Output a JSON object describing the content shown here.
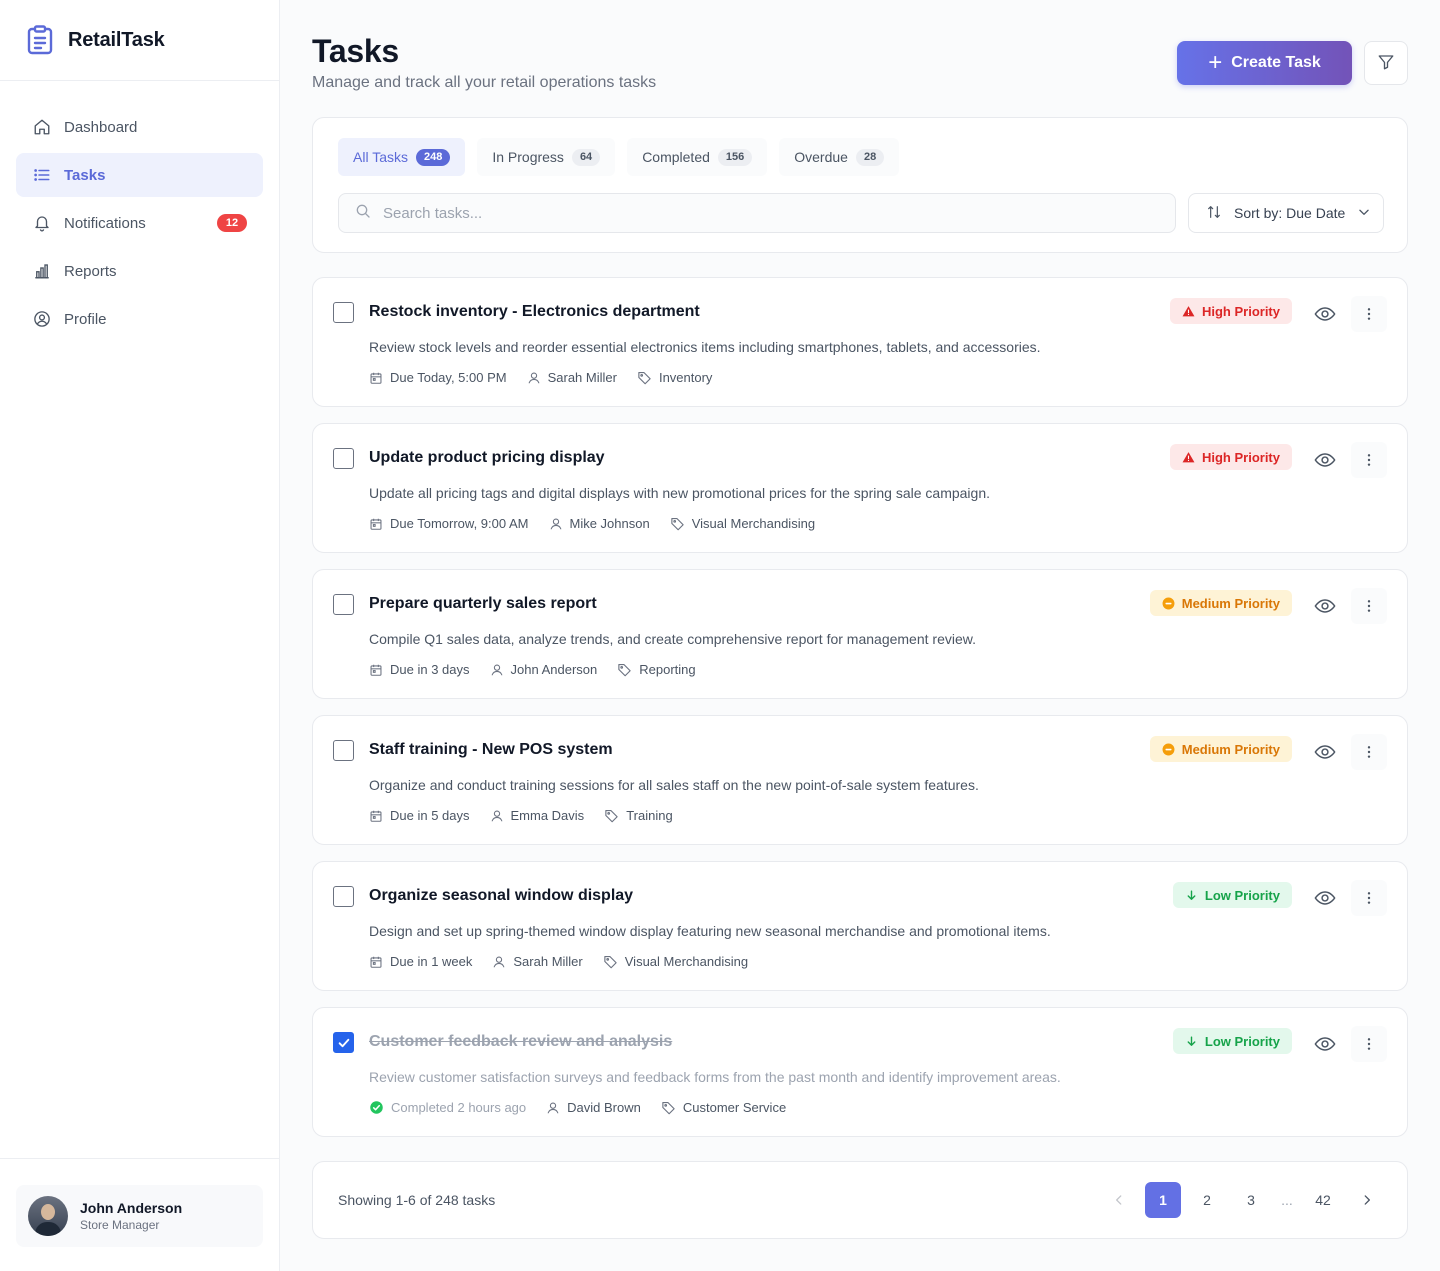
{
  "brand": {
    "name": "RetailTask"
  },
  "nav": [
    {
      "label": "Dashboard",
      "icon": "home-icon",
      "active": false
    },
    {
      "label": "Tasks",
      "icon": "list-icon",
      "active": true
    },
    {
      "label": "Notifications",
      "icon": "bell-icon",
      "active": false,
      "badge": "12"
    },
    {
      "label": "Reports",
      "icon": "bar-chart-icon",
      "active": false
    },
    {
      "label": "Profile",
      "icon": "user-circle-icon",
      "active": false
    }
  ],
  "user": {
    "name": "John Anderson",
    "role": "Store Manager"
  },
  "header": {
    "title": "Tasks",
    "subtitle": "Manage and track all your retail operations tasks",
    "create_label": "Create Task"
  },
  "tabs": [
    {
      "label": "All Tasks",
      "count": "248",
      "active": true
    },
    {
      "label": "In Progress",
      "count": "64",
      "active": false
    },
    {
      "label": "Completed",
      "count": "156",
      "active": false
    },
    {
      "label": "Overdue",
      "count": "28",
      "active": false
    }
  ],
  "search": {
    "placeholder": "Search tasks...",
    "value": ""
  },
  "sort": {
    "label": "Sort by: Due Date"
  },
  "tasks": [
    {
      "title": "Restock inventory - Electronics department",
      "description": "Review stock levels and reorder essential electronics items including smartphones, tablets, and accessories.",
      "due": "Due Today, 5:00 PM",
      "assignee": "Sarah Miller",
      "category": "Inventory",
      "priority": "High Priority",
      "level": "high",
      "completed": false
    },
    {
      "title": "Update product pricing display",
      "description": "Update all pricing tags and digital displays with new promotional prices for the spring sale campaign.",
      "due": "Due Tomorrow, 9:00 AM",
      "assignee": "Mike Johnson",
      "category": "Visual Merchandising",
      "priority": "High Priority",
      "level": "high",
      "completed": false
    },
    {
      "title": "Prepare quarterly sales report",
      "description": "Compile Q1 sales data, analyze trends, and create comprehensive report for management review.",
      "due": "Due in 3 days",
      "assignee": "John Anderson",
      "category": "Reporting",
      "priority": "Medium Priority",
      "level": "medium",
      "completed": false
    },
    {
      "title": "Staff training - New POS system",
      "description": "Organize and conduct training sessions for all sales staff on the new point-of-sale system features.",
      "due": "Due in 5 days",
      "assignee": "Emma Davis",
      "category": "Training",
      "priority": "Medium Priority",
      "level": "medium",
      "completed": false
    },
    {
      "title": "Organize seasonal window display",
      "description": "Design and set up spring-themed window display featuring new seasonal merchandise and promotional items.",
      "due": "Due in 1 week",
      "assignee": "Sarah Miller",
      "category": "Visual Merchandising",
      "priority": "Low Priority",
      "level": "low",
      "completed": false
    },
    {
      "title": "Customer feedback review and analysis",
      "description": "Review customer satisfaction surveys and feedback forms from the past month and identify improvement areas.",
      "due": "Completed 2 hours ago",
      "assignee": "David Brown",
      "category": "Customer Service",
      "priority": "Low Priority",
      "level": "low",
      "completed": true
    }
  ],
  "pagination": {
    "showing": "Showing 1-6 of 248 tasks",
    "pages": [
      "1",
      "2",
      "3",
      "...",
      "42"
    ],
    "current": "1"
  },
  "colors": {
    "accent": "#5b6ad8",
    "high": "#dc2626",
    "medium": "#d97706",
    "low": "#16a34a",
    "checked": "#2563eb"
  }
}
